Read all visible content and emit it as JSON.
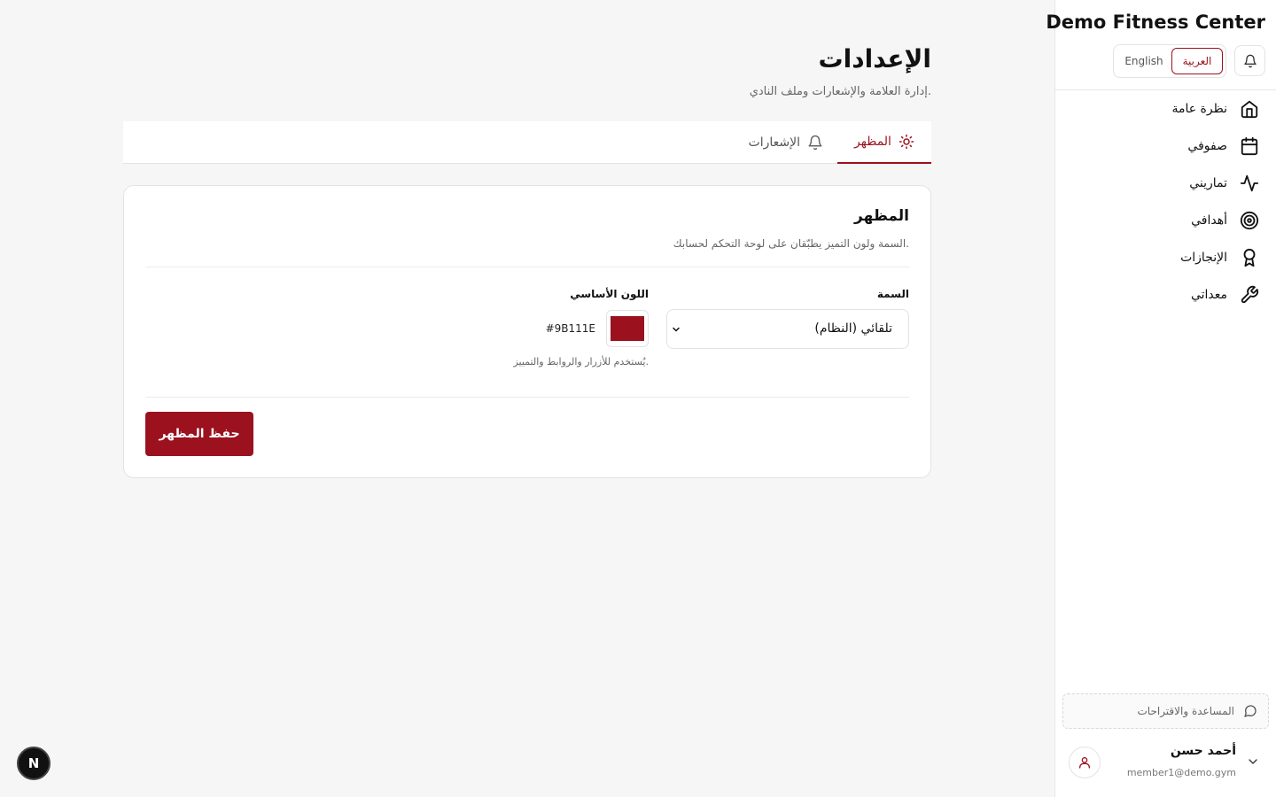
{
  "app": {
    "brand": "Demo Fitness Center"
  },
  "language": {
    "options": [
      "العربية",
      "English"
    ],
    "selected": "العربية"
  },
  "sidebar": {
    "items": [
      {
        "label": "نظرة عامة",
        "icon": "home-icon"
      },
      {
        "label": "صفوفي",
        "icon": "calendar-icon"
      },
      {
        "label": "تماريني",
        "icon": "activity-icon"
      },
      {
        "label": "أهدافي",
        "icon": "target-icon"
      },
      {
        "label": "الإنجازات",
        "icon": "award-icon"
      },
      {
        "label": "معداتي",
        "icon": "wrench-icon"
      }
    ],
    "help_label": "المساعدة والاقتراحات",
    "user": {
      "name": "أحمد حسن",
      "email": "member1@demo.gym"
    }
  },
  "page": {
    "title": "الإعدادات",
    "subtitle": "إدارة العلامة والإشعارات وملف النادي."
  },
  "tabs": [
    {
      "label": "المظهر",
      "icon": "sun-icon",
      "active": true
    },
    {
      "label": "الإشعارات",
      "icon": "bell-icon",
      "active": false
    }
  ],
  "appearance": {
    "title": "المظهر",
    "description": "السمة ولون التميز يطبّقان على لوحة التحكم لحسابك.",
    "theme_label": "السمة",
    "theme_value": "تلقائي (النظام)",
    "primary_color_label": "اللون الأساسي",
    "primary_color_hex": "#9B111E",
    "primary_color_help": "يُستخدم للأزرار والروابط والتمييز.",
    "save_label": "حفظ المظهر"
  },
  "dev_badge": "N",
  "colors": {
    "accent": "#9b111e",
    "background": "#f6f6f6"
  }
}
